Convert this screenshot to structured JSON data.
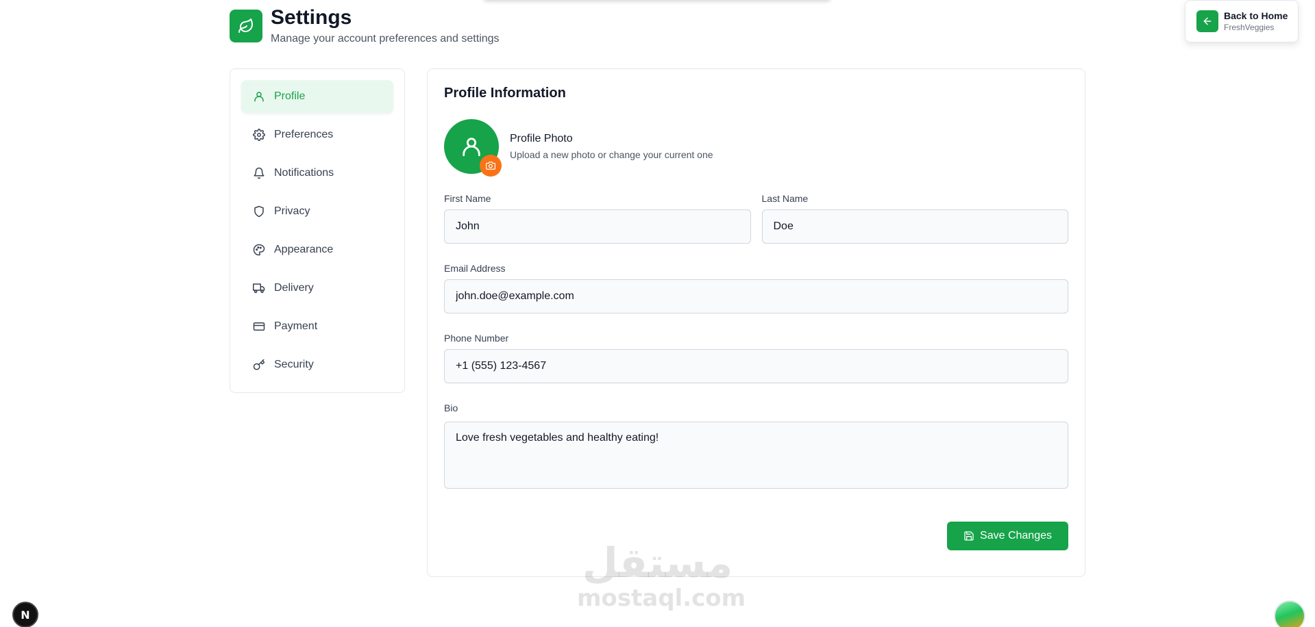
{
  "header": {
    "title": "Settings",
    "subtitle": "Manage your account preferences and settings",
    "logo_icon": "leaf-icon"
  },
  "back_card": {
    "title": "Back to Home",
    "subtitle": "FreshVeggies",
    "icon": "arrow-left-icon"
  },
  "sidebar": {
    "items": [
      {
        "label": "Profile",
        "icon": "user-icon",
        "active": true
      },
      {
        "label": "Preferences",
        "icon": "gear-icon",
        "active": false
      },
      {
        "label": "Notifications",
        "icon": "bell-icon",
        "active": false
      },
      {
        "label": "Privacy",
        "icon": "shield-icon",
        "active": false
      },
      {
        "label": "Appearance",
        "icon": "palette-icon",
        "active": false
      },
      {
        "label": "Delivery",
        "icon": "truck-icon",
        "active": false
      },
      {
        "label": "Payment",
        "icon": "credit-card-icon",
        "active": false
      },
      {
        "label": "Security",
        "icon": "key-icon",
        "active": false
      }
    ]
  },
  "profile": {
    "section_title": "Profile Information",
    "photo_title": "Profile Photo",
    "photo_subtitle": "Upload a new photo or change your current one",
    "first_name_label": "First Name",
    "first_name_value": "John",
    "last_name_label": "Last Name",
    "last_name_value": "Doe",
    "email_label": "Email Address",
    "email_value": "john.doe@example.com",
    "phone_label": "Phone Number",
    "phone_value": "+1 (555) 123-4567",
    "bio_label": "Bio",
    "bio_value": "Love fresh vegetables and healthy eating!",
    "save_label": "Save Changes"
  },
  "watermark": {
    "arabic": "مستقل",
    "latin": "mostaql.com"
  },
  "dev_badge": {
    "letter": "N"
  },
  "colors": {
    "accent": "#16a34a",
    "accent_light": "#e9f8ee",
    "camera": "#f97316"
  }
}
